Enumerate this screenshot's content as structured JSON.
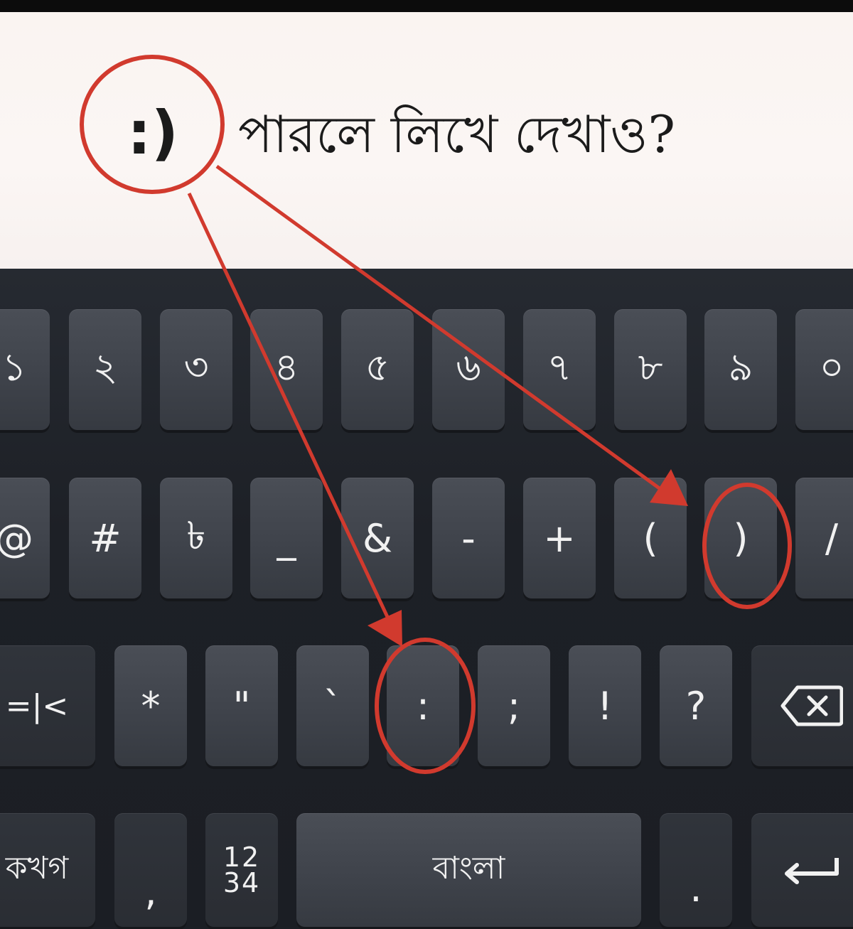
{
  "prompt": {
    "smiley": ":)",
    "question": "পারলে লিখে দেখাও?"
  },
  "keyboard": {
    "row1": [
      "১",
      "২",
      "৩",
      "৪",
      "৫",
      "৬",
      "৭",
      "৮",
      "৯",
      "০"
    ],
    "row2": [
      "@",
      "#",
      "৳",
      "_",
      "&",
      "-",
      "+",
      "(",
      ")",
      "/"
    ],
    "row3": {
      "shift_label": "=|<",
      "keys": [
        "*",
        "\"",
        "`",
        ":",
        ";",
        "!",
        "?"
      ],
      "backspace_icon": "backspace-icon"
    },
    "row4": {
      "alpha_label": "কখগ",
      "comma": ",",
      "numbers_top": "12",
      "numbers_bottom": "34",
      "space_label": "বাংলা",
      "period": ".",
      "enter_icon": "enter-icon"
    }
  },
  "annotations": {
    "color": "#d13a2e",
    "highlighted_keys": [
      ":",
      ")"
    ]
  }
}
